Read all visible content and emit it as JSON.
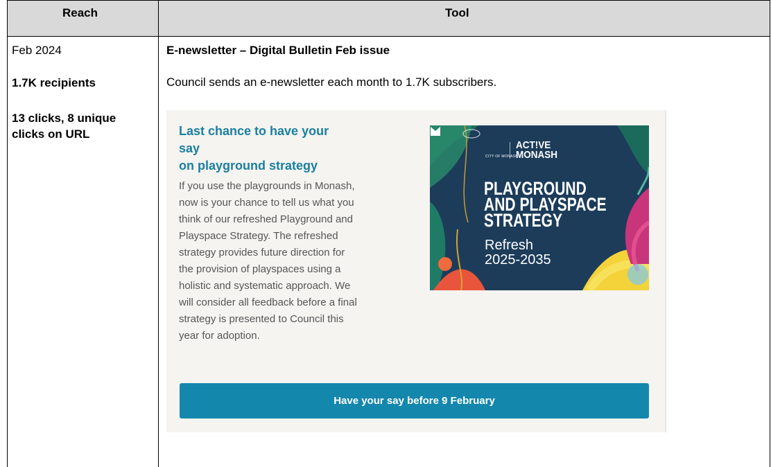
{
  "table": {
    "headers": {
      "reach": "Reach",
      "tool": "Tool"
    }
  },
  "reach": {
    "date": "Feb 2024",
    "recipients": "1.7K recipients",
    "clicks_line1": "13 clicks, 8 unique",
    "clicks_line2": "clicks on URL"
  },
  "tool": {
    "title": "E-newsletter – Digital Bulletin Feb issue",
    "description": "Council sends an e-newsletter each month to 1.7K subscribers."
  },
  "newsletter_card": {
    "heading_line1": "Last chance to have your say",
    "heading_line2": "on playground strategy",
    "body_lines": [
      "If you use the playgrounds in Monash,",
      "now is your chance to tell us what you",
      "think of our refreshed Playground and",
      "Playspace Strategy. The refreshed",
      "strategy provides future direction for",
      "the provision of playspaces using a",
      "holistic and systematic approach. We",
      "will consider all feedback before a final",
      "strategy is presented to Council this",
      "year for adoption."
    ],
    "button_label": "Have your say before 9 February",
    "accent_color": "#1487ad"
  },
  "poster": {
    "logo_caption": "CITY OF MONASH",
    "brand_line1": "ACT!VE",
    "brand_line2": "MONASH",
    "headline_lines": [
      "PLAYGROUND",
      "AND PLAYSPACE",
      "STRATEGY"
    ],
    "sub_line1": "Refresh",
    "sub_line2": "2025-2035"
  }
}
